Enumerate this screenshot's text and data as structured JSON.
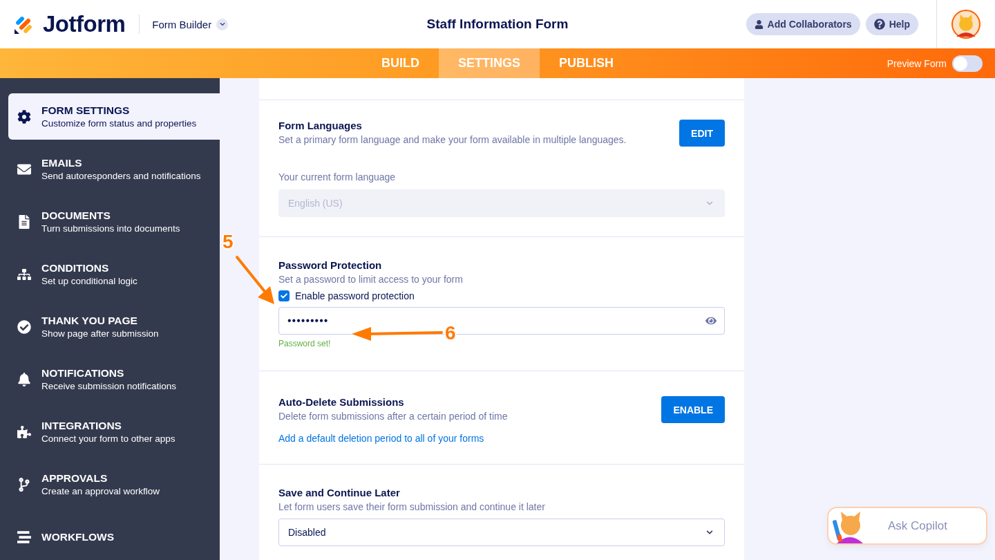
{
  "header": {
    "logo": "Jotform",
    "product": "Form Builder",
    "title": "Staff Information Form",
    "buttons": [
      {
        "kind": "collaborators",
        "label": "Add Collaborators"
      },
      {
        "kind": "help",
        "label": "Help"
      }
    ]
  },
  "nav": {
    "tabs": [
      {
        "label": "BUILD",
        "selected": false
      },
      {
        "label": "SETTINGS",
        "selected": true
      },
      {
        "label": "PUBLISH",
        "selected": false
      }
    ],
    "preview": {
      "label": "Preview Form",
      "on": false
    }
  },
  "sidebar": {
    "items": [
      {
        "title": "FORM SETTINGS",
        "subtitle": "Customize form status and properties",
        "selected": true
      },
      {
        "title": "EMAILS",
        "subtitle": "Send autoresponders and notifications",
        "selected": false
      },
      {
        "title": "DOCUMENTS",
        "subtitle": "Turn submissions into documents",
        "selected": false
      },
      {
        "title": "CONDITIONS",
        "subtitle": "Set up conditional logic",
        "selected": false
      },
      {
        "title": "THANK YOU PAGE",
        "subtitle": "Show page after submission",
        "selected": false
      },
      {
        "title": "NOTIFICATIONS",
        "subtitle": "Receive submission notifications",
        "selected": false
      },
      {
        "title": "INTEGRATIONS",
        "subtitle": "Connect your form to other apps",
        "selected": false
      },
      {
        "title": "APPROVALS",
        "subtitle": "Create an approval workflow",
        "selected": false
      },
      {
        "title": "WORKFLOWS",
        "selected": false
      }
    ]
  },
  "sections": [
    {
      "kind": "languages",
      "title": "Form Languages",
      "description": "Set a primary form language and make your form available in multiple languages.",
      "button": "EDIT",
      "field_label": "Your current form language",
      "select": {
        "value": "English (US)",
        "disabled": true
      }
    },
    {
      "kind": "password",
      "title": "Password Protection",
      "description": "Set a password to limit access to your form",
      "checkbox": {
        "label": "Enable password protection",
        "checked": true
      },
      "password": {
        "value": "•••••••••"
      },
      "status": "Password set!"
    },
    {
      "kind": "autodelete",
      "title": "Auto-Delete Submissions",
      "description": "Delete form submissions after a certain period of time",
      "button": "ENABLE",
      "link": "Add a default deletion period to all of your forms"
    },
    {
      "kind": "savelater",
      "title": "Save and Continue Later",
      "description": "Let form users save their form submission and continue it later",
      "select": {
        "value": "Disabled",
        "disabled": false
      }
    }
  ],
  "copilot": {
    "label": "Ask Copilot"
  },
  "annotations": [
    {
      "label": "5"
    },
    {
      "label": "6"
    }
  ]
}
